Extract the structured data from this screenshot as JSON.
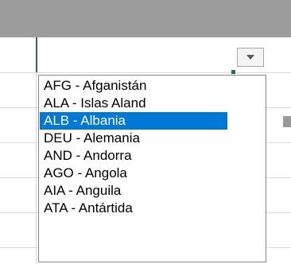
{
  "dropdown": {
    "selected_index": 2,
    "items": [
      {
        "label": "AFG - Afganistán"
      },
      {
        "label": "ALA - Islas Aland"
      },
      {
        "label": "ALB - Albania"
      },
      {
        "label": "DEU - Alemania"
      },
      {
        "label": "AND - Andorra"
      },
      {
        "label": "AGO - Angola"
      },
      {
        "label": "AIA - Anguila"
      },
      {
        "label": "ATA - Antártida"
      }
    ]
  },
  "colors": {
    "header": "#9c9c9c",
    "selection": "#0078d7",
    "active_cell_border": "#217346"
  },
  "icons": {
    "dropdown_arrow": "triangle-down-icon"
  }
}
